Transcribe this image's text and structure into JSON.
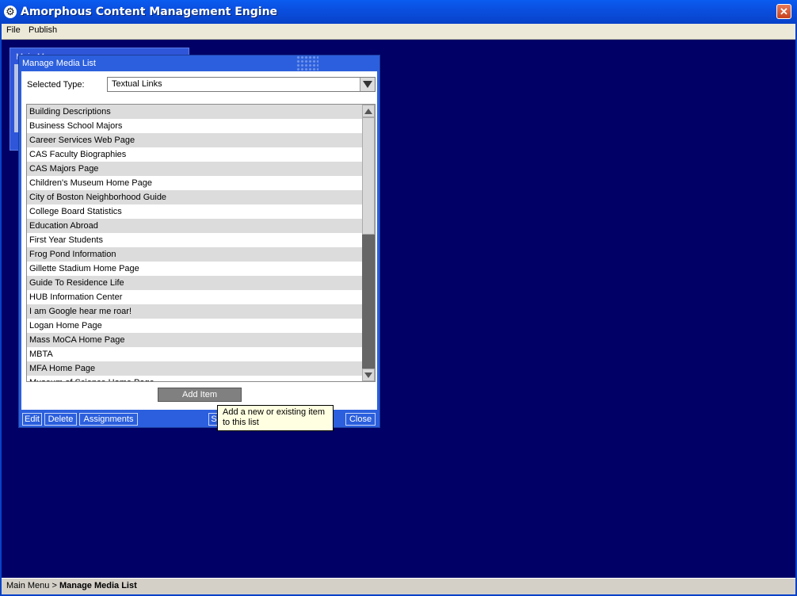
{
  "window": {
    "title": "Amorphous Content Management Engine",
    "close_glyph": "✕"
  },
  "menu": {
    "file": "File",
    "publish": "Publish"
  },
  "background_window": {
    "title": "Main Menu"
  },
  "dialog": {
    "title": "Manage Media List",
    "selected_type_label": "Selected Type:",
    "selected_type_value": "Textual Links",
    "items": [
      "Building Descriptions",
      "Business School Majors",
      "Career Services Web Page",
      "CAS Faculty Biographies",
      "CAS Majors Page",
      "Children's Museum Home Page",
      "City of Boston Neighborhood Guide",
      "College Board Statistics",
      "Education Abroad",
      "First Year Students",
      "Frog Pond Information",
      "Gillette Stadium Home Page",
      "Guide To Residence Life",
      "HUB Information Center",
      "I am Google hear me roar!",
      "Logan Home Page",
      "Mass MoCA Home Page",
      "MBTA",
      "MFA Home Page",
      "Museum of Science Home Page"
    ],
    "add_item": "Add Item",
    "buttons": {
      "edit": "Edit",
      "delete": "Delete",
      "assignments": "Assignments",
      "s_partial": "S",
      "close": "Close"
    }
  },
  "tooltip": {
    "text": "Add a new or existing item to this list"
  },
  "status": {
    "crumb_root": "Main Menu",
    "crumb_sep": " > ",
    "crumb_current": "Manage Media List"
  },
  "colors": {
    "desktop": "#000066",
    "titlebar": "#0a4fe0",
    "dialog": "#2b5fdd",
    "tooltip": "#ffffe1"
  }
}
